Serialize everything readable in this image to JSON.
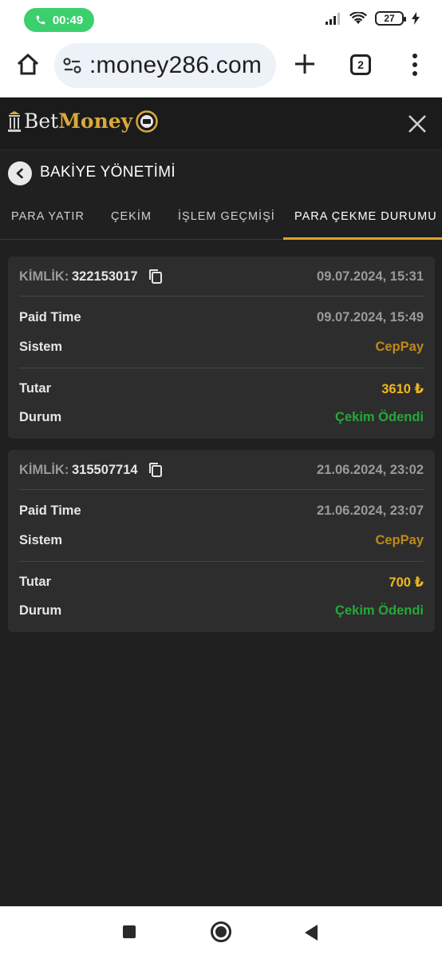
{
  "status_bar": {
    "time": "00:49",
    "battery": "27"
  },
  "browser": {
    "url": ":money286.com",
    "tab_count": "2"
  },
  "app": {
    "logo_part1": "Bet",
    "logo_part2": "Money"
  },
  "page": {
    "title": "BAKİYE YÖNETİMİ"
  },
  "tabs": [
    {
      "label": "PARA YATIR"
    },
    {
      "label": "ÇEKİM"
    },
    {
      "label": "İŞLEM GEÇMİŞİ"
    },
    {
      "label": "PARA ÇEKME DURUMU"
    }
  ],
  "active_tab": "PARA ÇEKME DURUMU",
  "withdrawals": [
    {
      "id_label": "KİMLİK:",
      "id": "322153017",
      "created": "09.07.2024, 15:31",
      "paid_time_label": "Paid Time",
      "paid_time": "09.07.2024, 15:49",
      "system_label": "Sistem",
      "system": "CepPay",
      "amount_label": "Tutar",
      "amount": "3610 ₺",
      "status_label": "Durum",
      "status": "Çekim Ödendi"
    },
    {
      "id_label": "KİMLİK:",
      "id": "315507714",
      "created": "21.06.2024, 23:02",
      "paid_time_label": "Paid Time",
      "paid_time": "21.06.2024, 23:07",
      "system_label": "Sistem",
      "system": "CepPay",
      "amount_label": "Tutar",
      "amount": "700 ₺",
      "status_label": "Durum",
      "status": "Çekim Ödendi"
    }
  ],
  "colors": {
    "accent": "#e0a32e",
    "amount": "#f0b81a",
    "system": "#c08a17",
    "status_paid": "#25a83a",
    "card_bg": "#2d2d2d",
    "page_bg": "#202020"
  }
}
